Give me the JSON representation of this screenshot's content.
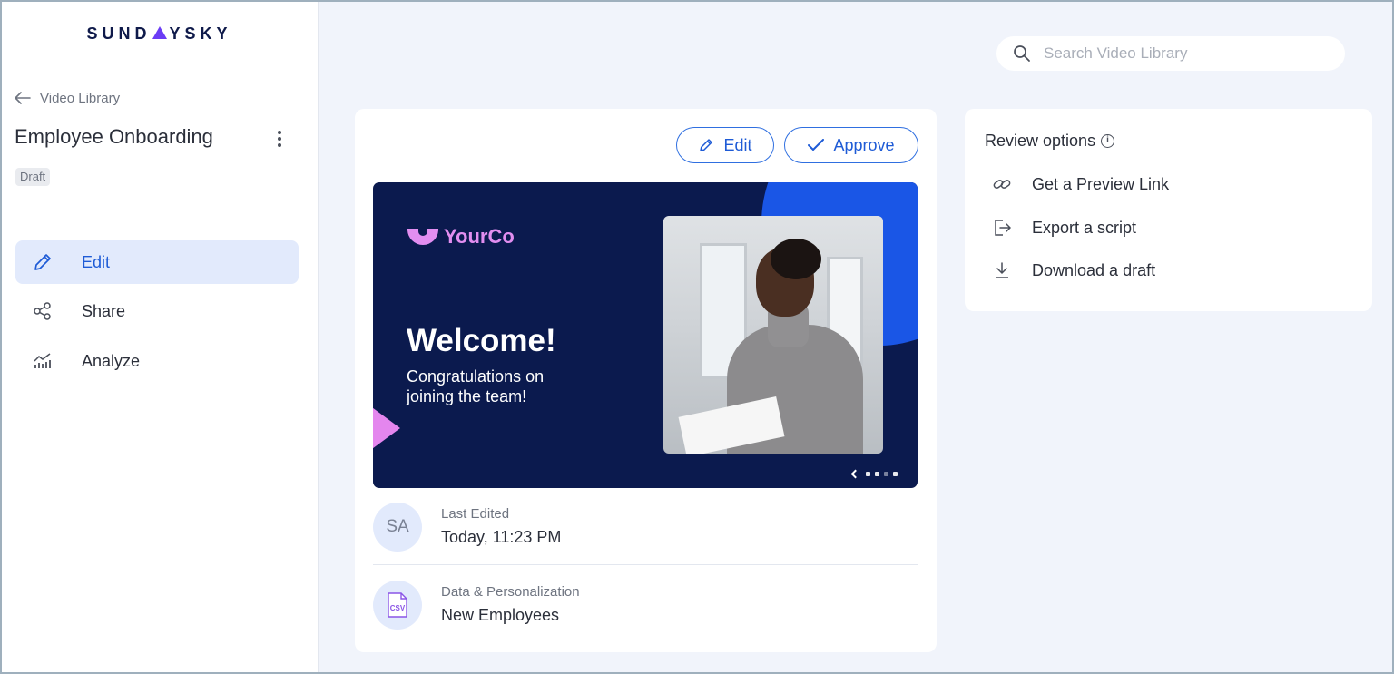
{
  "brand": {
    "logo_left": "SUND",
    "logo_right": "YSKY"
  },
  "sidebar": {
    "back_label": "Video Library",
    "title": "Employee Onboarding",
    "status": "Draft",
    "nav": [
      {
        "label": "Edit",
        "icon": "pencil-icon",
        "active": true
      },
      {
        "label": "Share",
        "icon": "share-icon",
        "active": false
      },
      {
        "label": "Analyze",
        "icon": "analytics-icon",
        "active": false
      }
    ]
  },
  "search": {
    "placeholder": "Search Video Library",
    "value": ""
  },
  "main": {
    "buttons": {
      "edit": "Edit",
      "approve": "Approve"
    },
    "preview": {
      "brand": "YourCo",
      "headline": "Welcome!",
      "subline": "Congratulations on joining the team!"
    },
    "last_edited": {
      "avatar": "SA",
      "label": "Last Edited",
      "value": "Today, 11:23 PM"
    },
    "data": {
      "icon_text": "CSV",
      "label": "Data & Personalization",
      "value": "New Employees"
    }
  },
  "review": {
    "title": "Review options",
    "options": [
      {
        "label": "Get a Preview Link",
        "icon": "link-icon"
      },
      {
        "label": "Export a script",
        "icon": "export-icon"
      },
      {
        "label": "Download a draft",
        "icon": "download-icon"
      }
    ]
  },
  "colors": {
    "accent": "#1e5bd6",
    "navy": "#0b1a4e",
    "pink": "#e28ef0",
    "active_bg": "#e2eafc"
  }
}
